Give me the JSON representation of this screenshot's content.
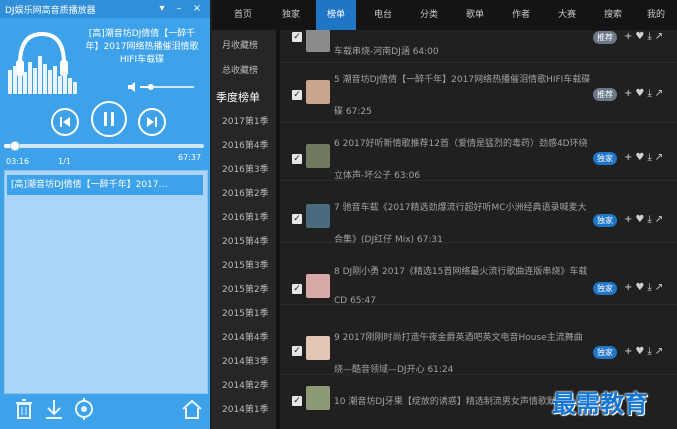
{
  "window": {
    "title": "DJ娱乐网高音质播放器",
    "dropdown_icon": "dropdown-arrow-icon",
    "minimize_icon": "minimize-icon",
    "close_icon": "close-icon"
  },
  "player": {
    "now_playing": "[高]潮音坊DJ倩倩【一醉千年】2017网络热播催泪情歌HIFI车载碟",
    "time_current": "03:16",
    "track_index": "1/1",
    "time_total": "67:37",
    "progress": 0.05,
    "volume": 0.2,
    "playlist": [
      "[高]潮音坊DJ倩倩【一醉千年】2017…"
    ],
    "colors": {
      "accent": "#3ea2ea",
      "dark_accent": "#2f8fd8",
      "playlist_bg": "#aad5f6"
    }
  },
  "nav": {
    "tabs": [
      "首页",
      "独家",
      "榜单",
      "电台",
      "分类",
      "歌单",
      "作者",
      "大赛",
      "搜索",
      "我的"
    ],
    "active_tab": "榜单"
  },
  "sidebar": {
    "items": [
      "月收藏榜",
      "总收藏榜",
      "季度榜单",
      "2017第1季",
      "2016第4季",
      "2016第3季",
      "2016第2季",
      "2016第1季",
      "2015第4季",
      "2015第3季",
      "2015第2季",
      "2015第1季",
      "2014第4季",
      "2014第3季",
      "2014第2季",
      "2014第1季"
    ],
    "active_item": "季度榜单"
  },
  "songs": [
    {
      "line1": "车载串烧-河南DJ涵 64:00",
      "line2": "",
      "badge": "推荐",
      "badge_color": "#6c7a88"
    },
    {
      "line1": "5 潮音坊DJ倩倩【一醉千年】2017网络热播催泪情歌HIFI车载碟",
      "line2": "碟 67:25",
      "badge": "推荐",
      "badge_color": "#6c7a88"
    },
    {
      "line1": "6 2017好听新情歌推荐12首（爱情是猛烈的毒药）劲感4D环绕",
      "line2": "立体声-坏公子 63:06",
      "badge": "独家",
      "badge_color": "#1f76c7"
    },
    {
      "line1": "7 驰音车载《2017精选劲爆流行超好听MC小洲经典语录喊麦大",
      "line2": "合集》(DJ红仔 Mix) 67:31",
      "badge": "独家",
      "badge_color": "#1f76c7"
    },
    {
      "line1": "8 DJ刚小勇 2017《精选15首网络最火流行歌曲连版串烧》车载",
      "line2": "CD 65:47",
      "badge": "独家",
      "badge_color": "#1f76c7"
    },
    {
      "line1": "9 2017刚刚时尚打造午夜金爵英酒吧英文电音House主流舞曲",
      "line2": "烧—酷音领域—DJ开心 61:24",
      "badge": "独家",
      "badge_color": "#1f76c7"
    },
    {
      "line1": "10 潮音坊DJ牙果【绽放的诱惑】精选制流男女声情歌默颂",
      "line2": "",
      "badge": "",
      "badge_color": "#1f76c7"
    }
  ],
  "row_actions": [
    "add-icon",
    "heart-icon",
    "download-icon",
    "share-icon"
  ],
  "watermark": "最需教育"
}
